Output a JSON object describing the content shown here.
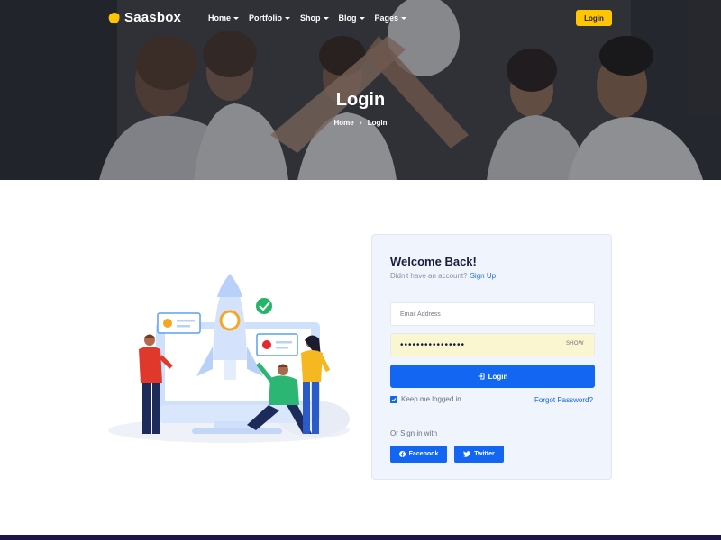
{
  "brand": {
    "name": "Saasbox",
    "accent": "#fec500",
    "primary": "#1266f1",
    "footer_color": "#1d1447"
  },
  "nav": {
    "items": [
      {
        "label": "Home"
      },
      {
        "label": "Portfolio"
      },
      {
        "label": "Shop"
      },
      {
        "label": "Blog"
      },
      {
        "label": "Pages"
      }
    ],
    "login_label": "Login"
  },
  "hero": {
    "title": "Login",
    "breadcrumb": [
      "Home",
      "Login"
    ]
  },
  "login": {
    "title": "Welcome Back!",
    "subtitle": "Didn't have an account?",
    "signup_link": "Sign Up",
    "email_placeholder": "Email Address",
    "password_value": "••••••••••••••••",
    "show_label": "SHOW",
    "submit_label": "Login",
    "remember_label": "Keep me logged in",
    "remember_checked": true,
    "forgot_label": "Forgot Password?",
    "or_label": "Or Sign in with",
    "social": [
      {
        "label": "Facebook",
        "icon": "facebook-icon"
      },
      {
        "label": "Twitter",
        "icon": "twitter-icon"
      }
    ]
  }
}
